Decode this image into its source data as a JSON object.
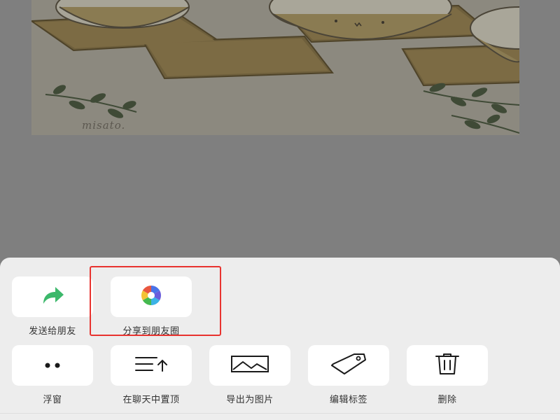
{
  "photo": {
    "caption": "misato."
  },
  "sheet": {
    "row1": [
      {
        "label": "发送给朋友",
        "icon": "forward-arrow-icon"
      },
      {
        "label": "分享到朋友圈",
        "icon": "moments-aperture-icon"
      }
    ],
    "row2": [
      {
        "label": "浮窗",
        "icon": "floating-window-icon"
      },
      {
        "label": "在聊天中置顶",
        "icon": "pin-to-top-icon"
      },
      {
        "label": "导出为图片",
        "icon": "image-export-icon"
      },
      {
        "label": "编辑标签",
        "icon": "tag-icon"
      },
      {
        "label": "删除",
        "icon": "trash-icon"
      }
    ]
  },
  "colors": {
    "overlay": "#7f7f7f",
    "sheet_bg": "#ededed",
    "tile_bg": "#ffffff",
    "forward_arrow": "#3cb86b",
    "highlight_border": "#e8332f"
  }
}
